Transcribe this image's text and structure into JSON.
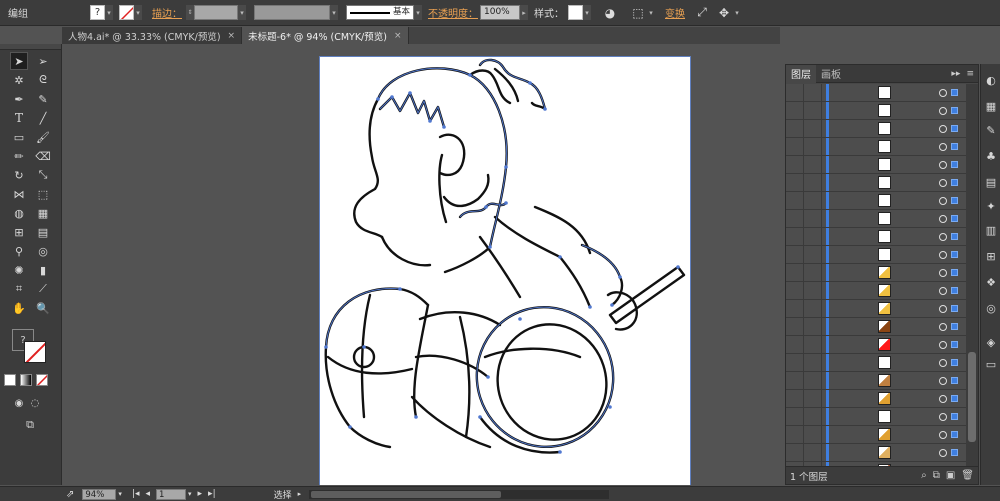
{
  "control_bar": {
    "selection_type": "编组",
    "stroke_label": "描边：",
    "stroke_profile": "基本",
    "opacity_label": "不透明度：",
    "opacity_value": "100%",
    "style_label": "样式：",
    "transform_label": "变换"
  },
  "tabs": [
    {
      "label": "人物4.ai* @ 33.33% (CMYK/预览)",
      "close": "×"
    },
    {
      "label": "未标题-6* @ 94% (CMYK/预览)",
      "close": "×"
    }
  ],
  "panel": {
    "tabs": [
      "图层",
      "画板"
    ],
    "menu_glyphs": [
      "▸▸",
      "≡"
    ],
    "layer_count": "1 个图层",
    "footer_icons": [
      "search-icon",
      "new-sublayer-icon",
      "new-layer-icon",
      "delete-icon"
    ],
    "layer_rows": 22,
    "thumb_colors": [
      "#ffffff",
      "#ffffff",
      "#ffffff",
      "#ffffff",
      "#ffffff",
      "#ffffff",
      "#ffffff",
      "#ffffff",
      "#ffffff",
      "#ffffff",
      "#f0c040",
      "#f0c040",
      "#f0c040",
      "#8b4513",
      "#ff1a1a",
      "#ffffff",
      "#c08040",
      "#e0a030",
      "#ffffff",
      "#e0a030",
      "#e0b060",
      "#a05030"
    ]
  },
  "status_bar": {
    "zoom": "94%",
    "artboard_number": "1",
    "tool_status": "选择"
  },
  "colors": {
    "accent": "#e8a052",
    "selection_blue": "#3f7fe0",
    "path_blue": "#5078d0"
  }
}
